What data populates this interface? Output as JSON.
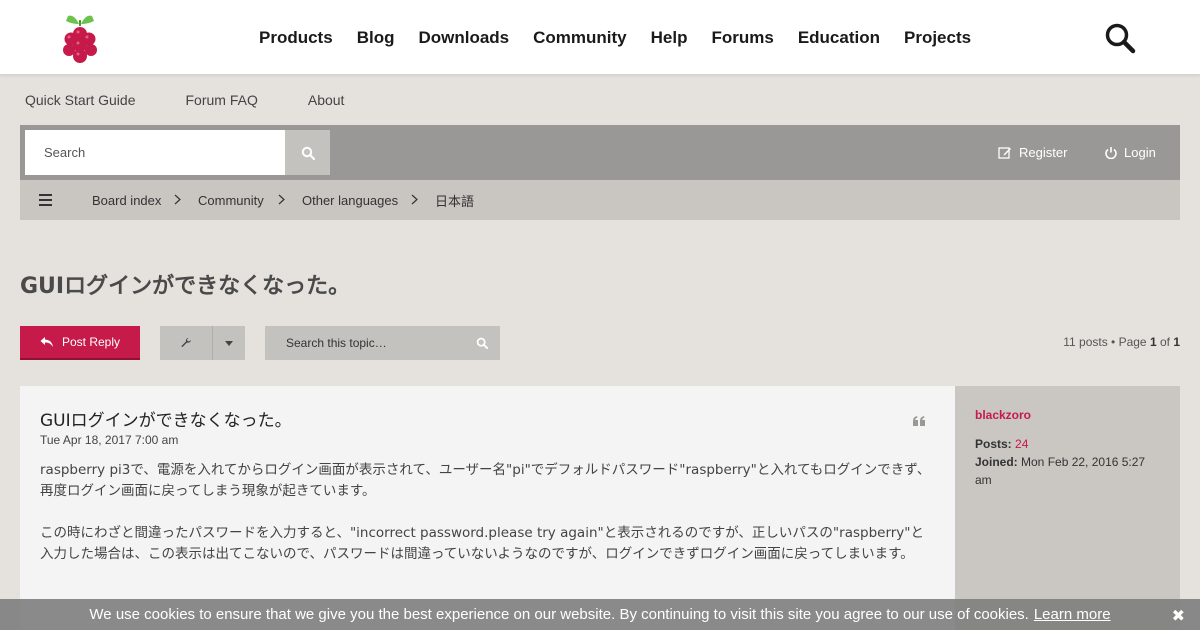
{
  "brand": {
    "accent": "#c51a4a",
    "logo_icon": "raspberry-logo"
  },
  "nav": {
    "items": [
      "Products",
      "Blog",
      "Downloads",
      "Community",
      "Help",
      "Forums",
      "Education",
      "Projects"
    ],
    "search_icon": "search-icon"
  },
  "sublinks": [
    "Quick Start Guide",
    "Forum FAQ",
    "About"
  ],
  "searchbar": {
    "placeholder": "Search",
    "register": "Register",
    "login": "Login"
  },
  "breadcrumb": [
    "Board index",
    "Community",
    "Other languages",
    "日本語"
  ],
  "topic": {
    "title": "GUIログインができなくなった。"
  },
  "actions": {
    "post_reply": "Post Reply",
    "search_topic_placeholder": "Search this topic…",
    "posts_count": "11 posts • Page ",
    "page_current": "1",
    "page_of": " of ",
    "page_total": "1"
  },
  "post": {
    "title": "GUIログインができなくなった。",
    "date": "Tue Apr 18, 2017 7:00 am",
    "paragraphs": [
      "raspberry pi3で、電源を入れてからログイン画面が表示されて、ユーザー名\"pi\"でデフォルドパスワード\"raspberry\"と入れてもログインできず、再度ログイン画面に戻ってしまう現象が起きています。",
      "この時にわざと間違ったパスワードを入力すると、\"incorrect password.please try again\"と表示されるのですが、正しいパスの\"raspberry\"と入力した場合は、この表示は出てこないので、パスワードは間違っていないようなのですが、ログインできずログイン画面に戻ってしまいます。"
    ]
  },
  "profile": {
    "username": "blackzoro",
    "posts_label": "Posts:",
    "posts_value": "24",
    "joined_label": "Joined:",
    "joined_value": "Mon Feb 22, 2016 5:27 am"
  },
  "cookie": {
    "text": "We use cookies to ensure that we give you the best experience on our website. By continuing to visit this site you agree to our use of cookies.",
    "learn_more": "Learn more",
    "close": "✖"
  }
}
